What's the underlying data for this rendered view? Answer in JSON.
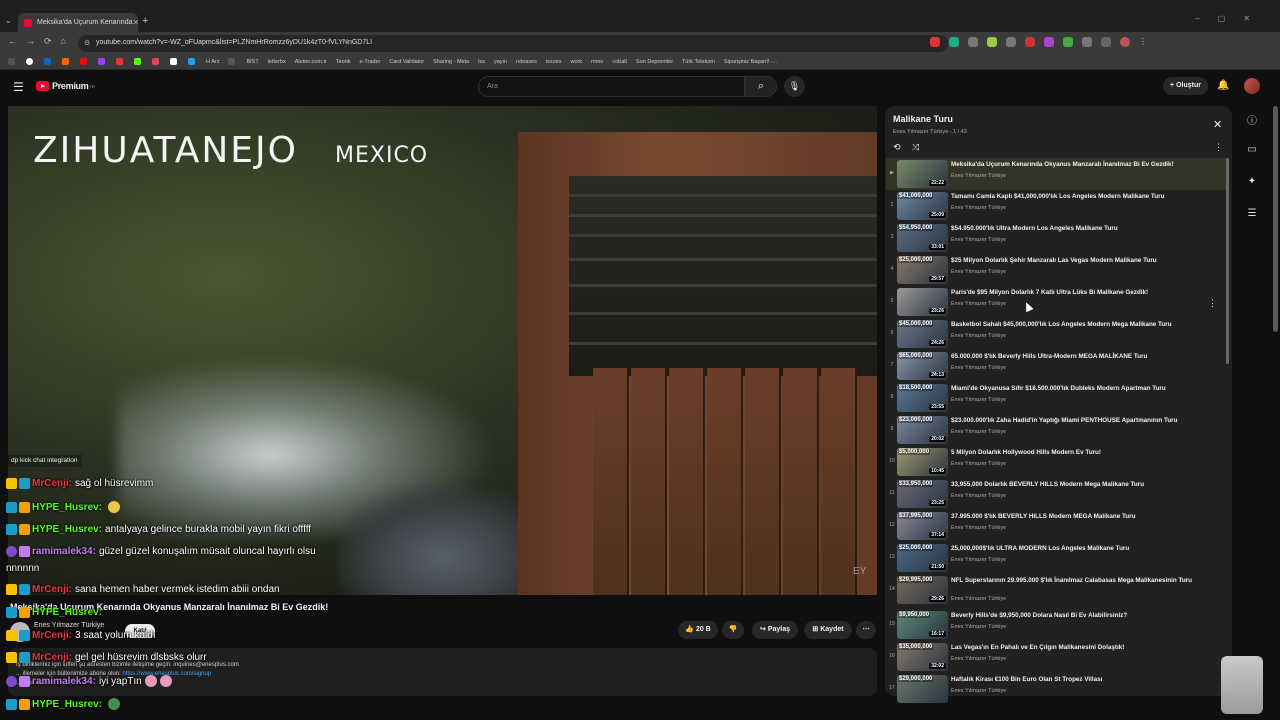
{
  "browser": {
    "tab_title": "Meksika'da Uçurum Kenarında",
    "url": "youtube.com/watch?v=-WZ_oFUapmc&list=PLZNmHrRomzz6yDU1k4zT0-fVLYNnGD7LI",
    "bookmarks": [
      "H Arz",
      "BIST",
      "letterbx",
      "Aletier.com.tr",
      "Teorik",
      "e-Trader",
      "Card Validator",
      "Sharing - Meta",
      "lss",
      "yayın",
      "releases",
      "issues",
      "work",
      "mmo",
      "cobalt",
      "Son Depremler",
      "Türk Telekom",
      "Siparişiniz Başarıl! -..."
    ]
  },
  "header": {
    "logo": "Premium",
    "logo_sup": "TR",
    "search_placeholder": "Ara",
    "create_label": "Oluştur"
  },
  "video": {
    "overlay_title": "ZIHUATANEJO",
    "overlay_subtitle": "MEXICO",
    "watermark": "EY",
    "title": "Meksika'da Uçurum Kenarında Okyanus Manzaralı İnanılmaz Bi Ev Gezdik!",
    "channel": "Enes Yılmazer Türkiye",
    "join_label": "Katıl",
    "likes": "20 B",
    "share_label": "Paylaş",
    "save_label": "Kaydet",
    "desc_line1": "İş birlikleriniz için lütfen şu adresten bizimle iletişime geçin: inquiries@enesplus.com",
    "desc_line2": "...",
    "desc_line2b": "illemeler için bültenimize abone olun:",
    "desc_link": "https://www.enesplus.com/signup",
    "desc_more": "...daha fazla"
  },
  "chat": {
    "integration_label": "dp kick chat integration",
    "messages": [
      {
        "user": "MrCenji:",
        "text": "sağ ol hüsrevimm",
        "color": "#e8383d"
      },
      {
        "user": "HYPE_Husrev:",
        "text": "",
        "color": "#53fc18"
      },
      {
        "user": "HYPE_Husrev:",
        "text": "antalyaya gelince burakla mobil yayın fikri offfff",
        "color": "#53fc18"
      },
      {
        "user": "ramimalek34:",
        "text": "güzel güzel konuşalım müsait oluncal hayırlı olsu",
        "color": "#c37bf5"
      },
      {
        "user": "",
        "text": "nnnnnn",
        "color": "#ffffff"
      },
      {
        "user": "MrCenji:",
        "text": "sana hemen haber vermek istedim abiii ondan",
        "color": "#e8383d"
      },
      {
        "user": "HYPE_Husrev:",
        "text": "",
        "color": "#53fc18"
      },
      {
        "user": "MrCenji:",
        "text": "3 saat yolum kaldı",
        "color": "#e8383d"
      },
      {
        "user": "MrCenji:",
        "text": "gel gel hüsrevim dlsbsks olurr",
        "color": "#e8383d"
      },
      {
        "user": "ramimalek34:",
        "text": "iyi yapTın",
        "color": "#c37bf5"
      },
      {
        "user": "HYPE_Husrev:",
        "text": "",
        "color": "#53fc18"
      }
    ]
  },
  "playlist": {
    "title": "Malikane Turu",
    "subtitle": "Enes Yılmazer Türkiye - 1 / 43",
    "items": [
      {
        "num": "▶",
        "title": "Meksika'da Uçurum Kenarında Okyanus Manzaralı İnanılmaz Bi Ev Gezdik!",
        "channel": "Enes Yılmazer Türkiye",
        "duration": "22:22",
        "tag": ""
      },
      {
        "num": "2",
        "title": "Tamamı Camla Kaplı $41,000,000'lık Los Angeles Modern Malikane Turu",
        "channel": "Enes Yılmazer Türkiye",
        "duration": "25:09",
        "tag": "$41,000,000"
      },
      {
        "num": "3",
        "title": "$54.950.000'lık Ultra Modern Los Angeles Malikane Turu",
        "channel": "Enes Yılmazer Türkiye",
        "duration": "33:01",
        "tag": "$54,950,000"
      },
      {
        "num": "4",
        "title": "$25 Milyon Dolarlık Şehir Manzaralı Las Vegas Modern Malikane Turu",
        "channel": "Enes Yılmazer Türkiye",
        "duration": "29:57",
        "tag": "$25,000,000"
      },
      {
        "num": "5",
        "title": "Paris'de $95 Milyon Dolarlık 7 Katlı Ultra Lüks Bi Malikane Gezdik!",
        "channel": "Enes Yılmazer Türkiye",
        "duration": "23:26",
        "tag": ""
      },
      {
        "num": "6",
        "title": "Basketbol Sahalı $45,000,000'lık Los Angeles Modern Mega Malikane Turu",
        "channel": "Enes Yılmazer Türkiye",
        "duration": "24:26",
        "tag": "$45,000,000"
      },
      {
        "num": "7",
        "title": "65.000.000 $'lık Beverly Hills Ultra-Modern MEGA MALİKANE Turu",
        "channel": "Enes Yılmazer Türkiye",
        "duration": "24:13",
        "tag": "$65,000,000"
      },
      {
        "num": "8",
        "title": "Miami'de Okyanusa Sıfır $18.500.000'lık Dubleks Modern Apartman Turu",
        "channel": "Enes Yılmazer Türkiye",
        "duration": "23:55",
        "tag": "$18,500,000"
      },
      {
        "num": "9",
        "title": "$23.000.000'lık Zaha Hadid'in Yaptığı Miami PENTHOUSE Apartmanının Turu",
        "channel": "Enes Yılmazer Türkiye",
        "duration": "20:02",
        "tag": "$23,000,000"
      },
      {
        "num": "10",
        "title": "5 Milyon Dolarlık Hollywood Hills Modern Ev Turu!",
        "channel": "Enes Yılmazer Türkiye",
        "duration": "10:45",
        "tag": "$5,000,000"
      },
      {
        "num": "11",
        "title": "33,955,000 Dolarlık BEVERLY HILLS Modern Mega Malikane Turu",
        "channel": "Enes Yılmazer Türkiye",
        "duration": "23:25",
        "tag": "$33,950,000"
      },
      {
        "num": "12",
        "title": "37.995.000 $'lık BEVERLY HILLS Modern MEGA Malikane Turu",
        "channel": "Enes Yılmazer Türkiye",
        "duration": "37:14",
        "tag": "$37,995,000"
      },
      {
        "num": "13",
        "title": "25,000,000$'lık ULTRA MODERN Los Angeles Malikane Turu",
        "channel": "Enes Yılmazer Türkiye",
        "duration": "21:50",
        "tag": "$25,000,000"
      },
      {
        "num": "14",
        "title": "NFL Superstarının 29.995.000 $'lık İnanılmaz Calabasas Mega Malikanesinin Turu",
        "channel": "Enes Yılmazer Türkiye",
        "duration": "29:26",
        "tag": "$29,995,000"
      },
      {
        "num": "15",
        "title": "Beverly Hills'de $9,950,000 Dolara Nasıl Bi Ev Alabilirsiniz?",
        "channel": "Enes Yılmazer Türkiye",
        "duration": "16:17",
        "tag": "$9,950,000"
      },
      {
        "num": "16",
        "title": "Las Vegas'ın En Pahalı ve En Çılgın Malikanesini Dolaştık!",
        "channel": "Enes Yılmazer Türkiye",
        "duration": "32:02",
        "tag": "$35,000,000"
      },
      {
        "num": "17",
        "title": "Haftalık Kirası €100 Bin Euro Olan St Tropez Villası",
        "channel": "Enes Yılmazer Türkiye",
        "duration": "",
        "tag": "$29,000,000"
      }
    ]
  }
}
